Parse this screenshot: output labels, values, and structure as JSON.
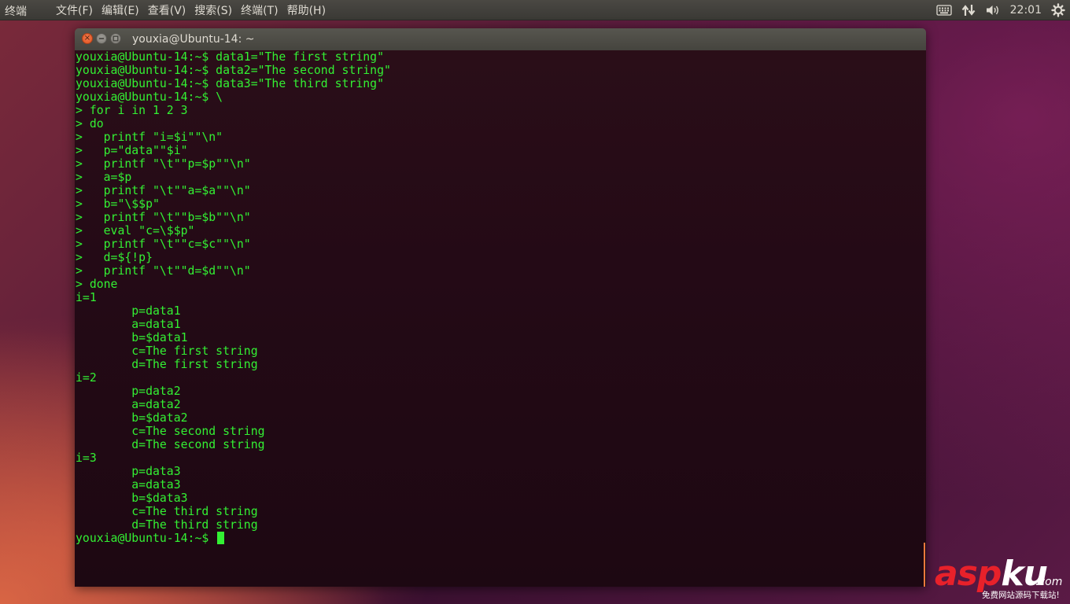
{
  "panel": {
    "app_name": "终端",
    "menu": [
      "文件(F)",
      "编辑(E)",
      "查看(V)",
      "搜索(S)",
      "终端(T)",
      "帮助(H)"
    ],
    "indicators": {
      "keyboard_icon": "keyboard-icon",
      "network_icon": "network-updown-icon",
      "volume_icon": "volume-icon",
      "clock": "22:01",
      "settings_icon": "gear-icon"
    }
  },
  "window": {
    "title": "youxia@Ubuntu-14: ~",
    "close_glyph": "×"
  },
  "terminal": {
    "lines": [
      "youxia@Ubuntu-14:~$ data1=\"The first string\"",
      "youxia@Ubuntu-14:~$ data2=\"The second string\"",
      "youxia@Ubuntu-14:~$ data3=\"The third string\"",
      "youxia@Ubuntu-14:~$ \\",
      "> for i in 1 2 3",
      "> do",
      ">   printf \"i=$i\"\"\\n\"",
      ">   p=\"data\"\"$i\"",
      ">   printf \"\\t\"\"p=$p\"\"\\n\"",
      ">   a=$p",
      ">   printf \"\\t\"\"a=$a\"\"\\n\"",
      ">   b=\"\\$$p\"",
      ">   printf \"\\t\"\"b=$b\"\"\\n\"",
      ">   eval \"c=\\$$p\"",
      ">   printf \"\\t\"\"c=$c\"\"\\n\"",
      ">   d=${!p}",
      ">   printf \"\\t\"\"d=$d\"\"\\n\"",
      "> done",
      "i=1",
      "        p=data1",
      "        a=data1",
      "        b=$data1",
      "        c=The first string",
      "        d=The first string",
      "i=2",
      "        p=data2",
      "        a=data2",
      "        b=$data2",
      "        c=The second string",
      "        d=The second string",
      "i=3",
      "        p=data3",
      "        a=data3",
      "        b=$data3",
      "        c=The third string",
      "        d=The third string"
    ],
    "prompt": "youxia@Ubuntu-14:~$ "
  },
  "watermark": {
    "logo_red": "asp",
    "logo_white": "ku",
    "dotcom": ".com",
    "sub": "免费网站源码下载站!"
  },
  "colors": {
    "terminal_text": "#33f033",
    "close_button": "#e9662e",
    "panel_bg": "#3c3b37"
  }
}
